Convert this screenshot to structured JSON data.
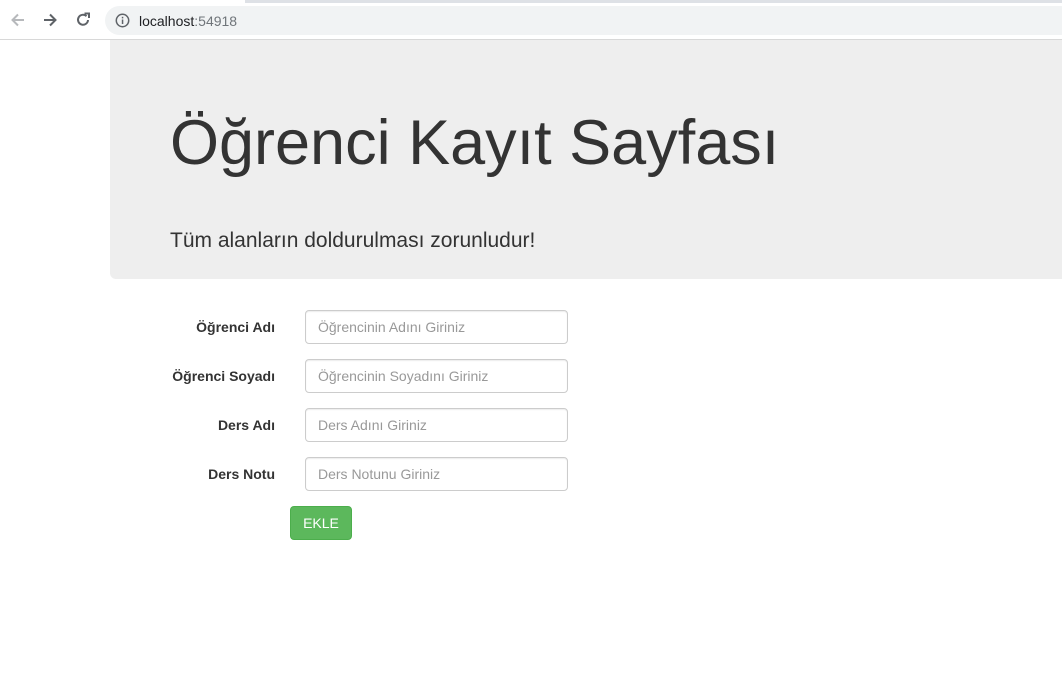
{
  "browser": {
    "url_host": "localhost",
    "url_port": ":54918",
    "icons": {
      "back": "back-arrow-icon",
      "forward": "forward-arrow-icon",
      "reload": "reload-icon",
      "info": "info-icon"
    }
  },
  "header": {
    "title": "Öğrenci Kayıt Sayfası",
    "subtitle": "Tüm alanların doldurulması zorunludur!"
  },
  "form": {
    "fields": [
      {
        "label": "Öğrenci Adı",
        "placeholder": "Öğrencinin Adını Giriniz",
        "value": ""
      },
      {
        "label": "Öğrenci Soyadı",
        "placeholder": "Öğrencinin Soyadını Giriniz",
        "value": ""
      },
      {
        "label": "Ders Adı",
        "placeholder": "Ders Adını Giriniz",
        "value": ""
      },
      {
        "label": "Ders Notu",
        "placeholder": "Ders Notunu Giriniz",
        "value": ""
      }
    ],
    "submit_label": "EKLE"
  },
  "colors": {
    "jumbotron_bg": "#eeeeee",
    "button_bg": "#5cb85c",
    "button_border": "#4cae4c",
    "text": "#333333"
  }
}
